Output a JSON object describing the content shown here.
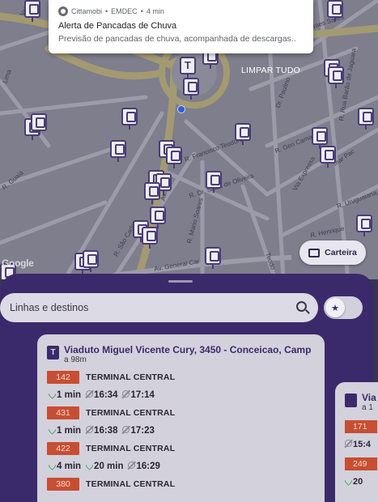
{
  "notification": {
    "app": "Cittamobi",
    "sender": "EMDEC",
    "age": "4 min",
    "title": "Alerta de Pancadas de Chuva",
    "text": "Previsão de pancadas de chuva, acompanhada de descargas..",
    "icon": "cittamobi-app-icon"
  },
  "map": {
    "clear_all_label": "LIMPAR TUDO",
    "wallet_label": "Carteira",
    "google_label": "Google",
    "streets": [
      "R. Francisco Teodoro",
      "R. Dr. Sales de Oliveira",
      "R. Gen Camara",
      "R. Mario Soares",
      "R. São Carlos",
      "Av. General Car",
      "Via Expressa",
      "R. Uruguaiana",
      "R. Henrique",
      "R. Rua Barão de Jaguara",
      "Dr. Paulino",
      "R. Guaiá",
      "raes Salles",
      "Av.",
      "mar Pac",
      "Lima",
      "Teodo",
      "Velho"
    ]
  },
  "search": {
    "placeholder": "Linhas e destinos",
    "favorite_icon": "star-icon"
  },
  "card": {
    "stop_badge": "T",
    "stop_name": "Viaduto Miguel Vicente Cury, 3450 - Conceicao, Camp",
    "distance": "a 98m",
    "routes": [
      {
        "line": "142",
        "destination": "TERMINAL CENTRAL",
        "times": [
          {
            "type": "realtime",
            "value": "1 min"
          },
          {
            "type": "scheduled",
            "value": "16:34"
          },
          {
            "type": "scheduled",
            "value": "17:14"
          }
        ]
      },
      {
        "line": "431",
        "destination": "TERMINAL CENTRAL",
        "times": [
          {
            "type": "realtime",
            "value": "1 min"
          },
          {
            "type": "scheduled",
            "value": "16:38"
          },
          {
            "type": "scheduled",
            "value": "17:23"
          }
        ]
      },
      {
        "line": "422",
        "destination": "TERMINAL CENTRAL",
        "times": [
          {
            "type": "realtime",
            "value": "4 min"
          },
          {
            "type": "realtime",
            "value": "20 min"
          },
          {
            "type": "scheduled",
            "value": "16:29"
          }
        ]
      },
      {
        "line": "380",
        "destination": "TERMINAL CENTRAL",
        "times": []
      }
    ]
  },
  "card2": {
    "stop_name": "Via",
    "distance": "a 1",
    "lines": [
      "171",
      "249"
    ],
    "times": [
      "15:4",
      "20"
    ]
  },
  "colors": {
    "sheet": "#3b2a6b",
    "line_badge": "#c74e32",
    "card": "#d3d1db",
    "realtime": "#3fa36a"
  }
}
